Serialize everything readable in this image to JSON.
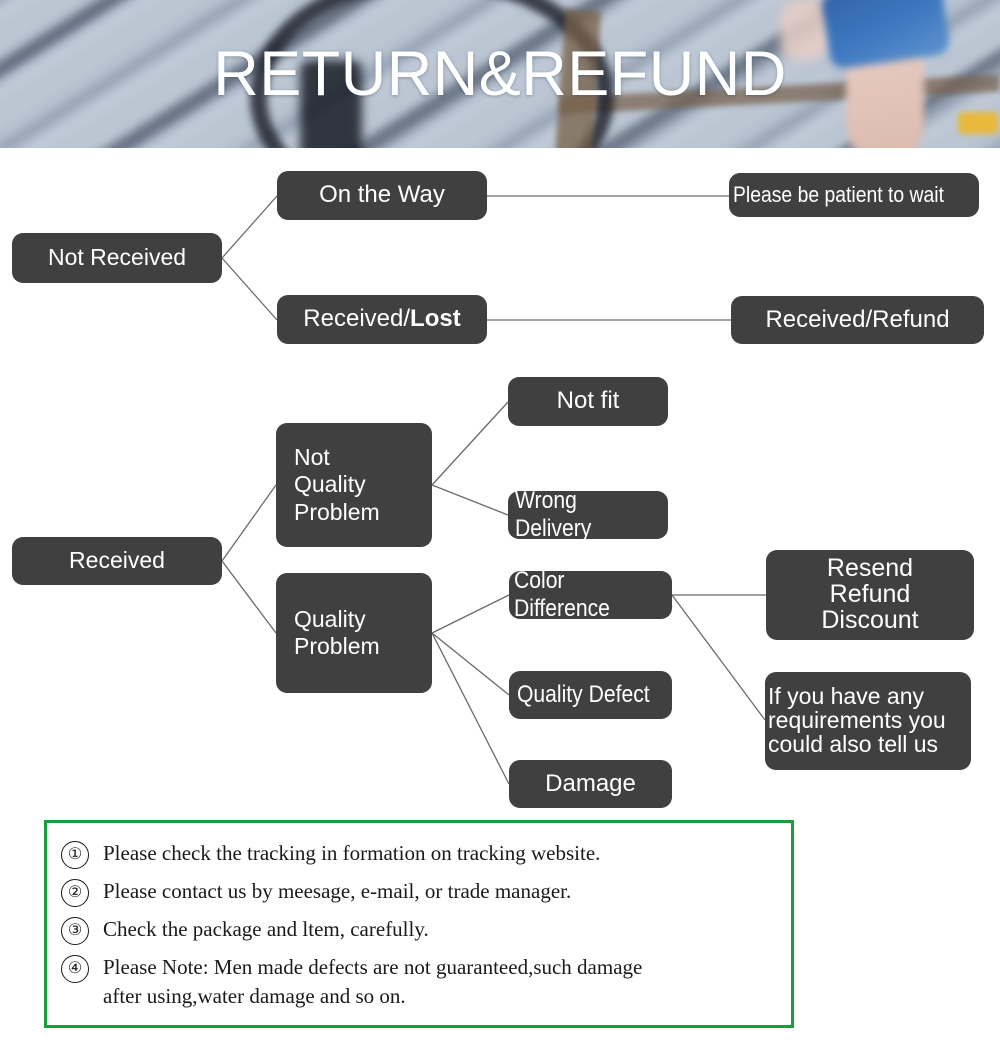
{
  "banner": {
    "title": "RETURN&REFUND",
    "image_desc": "blurred photo of a wooden deck with a bicycle and a person's leg in blue denim shorts"
  },
  "colors": {
    "node_fill": "#404040",
    "node_text": "#ffffff",
    "connector": "#6a6a6a",
    "notes_border": "#16a03a",
    "banner_title": "#ffffff"
  },
  "flowchart": {
    "nodes": [
      {
        "id": "not-received",
        "label": "Not Received"
      },
      {
        "id": "on-the-way",
        "label": "On the Way"
      },
      {
        "id": "received-lost",
        "label": "Received/",
        "label_bold": "Lost"
      },
      {
        "id": "please-wait",
        "label": "Please be patient to wait"
      },
      {
        "id": "received-refund",
        "label": "Received/Refund"
      },
      {
        "id": "received",
        "label": "Received"
      },
      {
        "id": "not-quality",
        "label": "Not\nQuality\nProblem"
      },
      {
        "id": "quality-problem",
        "label": "Quality\nProblem"
      },
      {
        "id": "not-fit",
        "label": "Not fit"
      },
      {
        "id": "wrong-delivery",
        "label": "Wrong Delivery"
      },
      {
        "id": "color-diff",
        "label": "Color Difference"
      },
      {
        "id": "quality-defect",
        "label": "Quality Defect"
      },
      {
        "id": "damage",
        "label": "Damage"
      },
      {
        "id": "resend",
        "label": "Resend\nRefund\nDiscount"
      },
      {
        "id": "requirements",
        "label": "If you have any\nrequirements you\ncould also tell us"
      }
    ]
  },
  "notes": {
    "items": [
      {
        "num": "①",
        "text": "Please check the tracking in formation on tracking website."
      },
      {
        "num": "②",
        "text": "Please contact us by meesage, e-mail, or trade manager."
      },
      {
        "num": "③",
        "text": "Check the package and ltem, carefully."
      },
      {
        "num": "④",
        "text": "Please Note: Men made defects  are not guaranteed,such damage\nafter using,water damage and so on."
      }
    ]
  }
}
